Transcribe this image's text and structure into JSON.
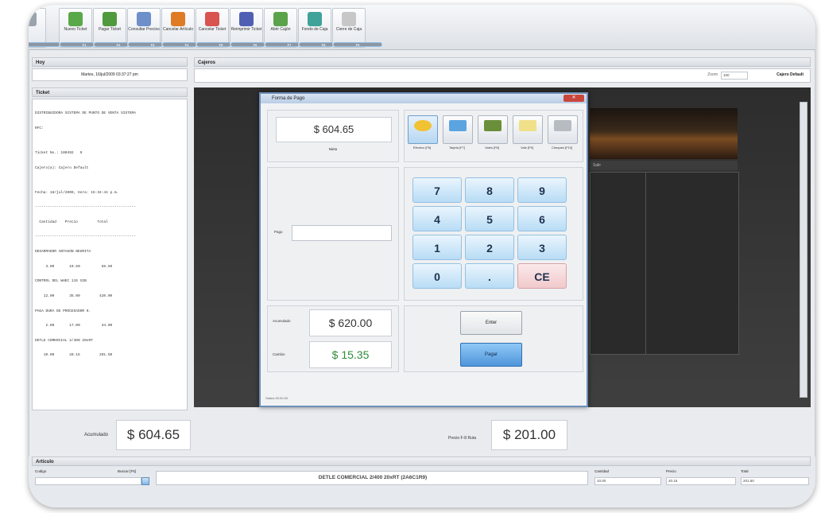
{
  "toolbar": {
    "buttons": [
      {
        "label": "",
        "key": "",
        "icon": "partial-button-icon",
        "color": "#9aa3ad"
      },
      {
        "label": "Nuevo Ticket",
        "key": "F1",
        "icon": "new-ticket-icon",
        "color": "#59a84a"
      },
      {
        "label": "Pagar Ticket",
        "key": "F2",
        "icon": "pay-ticket-icon",
        "color": "#4f9a3d"
      },
      {
        "label": "Consultar Precios",
        "key": "F3",
        "icon": "price-check-icon",
        "color": "#6e8fc9"
      },
      {
        "label": "Cancelar Artículo",
        "key": "F4",
        "icon": "cancel-item-icon",
        "color": "#e07b25"
      },
      {
        "label": "Cancelar Ticket",
        "key": "F5",
        "icon": "cancel-ticket-icon",
        "color": "#d9534f"
      },
      {
        "label": "Reimprimir Ticket",
        "key": "F6",
        "icon": "reprint-icon",
        "color": "#4e5fb4"
      },
      {
        "label": "Abrir Cajón",
        "key": "F7",
        "icon": "open-drawer-icon",
        "color": "#5aa34a"
      },
      {
        "label": "Fondo de Caja",
        "key": "F8",
        "icon": "cash-fund-icon",
        "color": "#3fa39a"
      },
      {
        "label": "Cierre de Caja",
        "key": "F9",
        "icon": "close-register-icon",
        "color": "#c7c7c7"
      }
    ]
  },
  "left_panel": {
    "title": "Hoy",
    "datetime": "Martes, 16/jul/2009  03:37:27 pm",
    "ticket_title": "Ticket",
    "ticket_lines": [
      "DISTRIBUIDORA SISTEMA DE PUNTO DE VENTA SISTEMA",
      "RFC:",
      "",
      "Ticket No.: 100492   9",
      "Cajero(a): Cajero Default",
      "",
      "Fecha: 16/jul/2009, Hora: 15:34:44 p.m.",
      "-----------------------------------------------",
      "  Cantidad    Precio         Total",
      "-----------------------------------------------",
      "DESARMADOR ANTAGON NEGRITA",
      "     3.00       19.50          58.50",
      "CONTROL DEL WHEC 115 X2B",
      "    12.00       35.00         420.00",
      "PAGA DURA DE PROCESADOR 0.",
      "     2.00       17.00          34.00",
      "DETLE COMERCIAL 2/400 20xRT",
      "    10.00       20.15         201.50"
    ],
    "total_label": "Acumulado",
    "total_value": "$  604.65"
  },
  "main": {
    "title": "Cajeros",
    "zoom_label": "Zoom",
    "zoom_value": "100",
    "cashier": "Cajero Default",
    "caption_tab": "Salir",
    "subtotal_label": "Precio F-8 Ruta",
    "subtotal_value": "$  201.00"
  },
  "dialog": {
    "title": "Forma de Pago",
    "close": "✕",
    "amount_due": "$  604.65",
    "amount_due_label": "Nieto",
    "pay_methods": [
      {
        "label": "Efectivo [F6]",
        "icon": "cash-coins-icon",
        "color": "#f1c232"
      },
      {
        "label": "Tarjeta [F7]",
        "icon": "credit-card-icon",
        "color": "#5ba4e0"
      },
      {
        "label": "Vales [F8]",
        "icon": "voucher-icon",
        "color": "#6a8f3a"
      },
      {
        "label": "Vale [F9]",
        "icon": "gift-card-icon",
        "color": "#f0e08a"
      },
      {
        "label": "Cheques [F10]",
        "icon": "check-icon",
        "color": "#b7bcc3"
      }
    ],
    "pago_label": "Pago",
    "pago_value": "",
    "keypad": [
      "7",
      "8",
      "9",
      "4",
      "5",
      "6",
      "1",
      "2",
      "3",
      "0",
      ".",
      "CE"
    ],
    "received_label": "Acumulado",
    "received_value": "$  620.00",
    "change_label": "Cambio",
    "change_value": "$  15.35",
    "change_color": "#2e8b3a",
    "enter_label": "Enter",
    "pay_label": "Pagar",
    "status": "Status   00:00:00"
  },
  "bottom": {
    "title": "Articulo",
    "code_label": "Codigo",
    "search_label": "Buscar [F5]",
    "product": "DETLE COMERCIAL 2/400 20xRT (2A6C1R9)",
    "qty_label": "Cantidad",
    "qty_value": "10.00",
    "price_label": "Precio",
    "price_value": "20.15",
    "total_label": "Total",
    "total_value": "201.50"
  }
}
